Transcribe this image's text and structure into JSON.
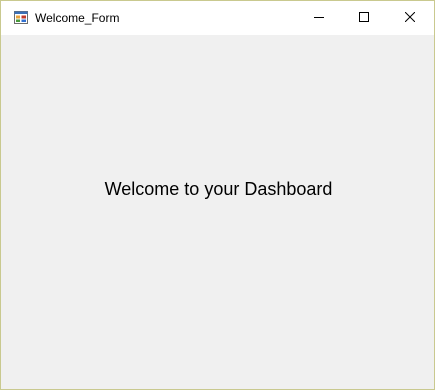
{
  "window": {
    "title": "Welcome_Form",
    "icon": "form-app-icon",
    "controls": {
      "minimize": "minimize-icon",
      "maximize": "maximize-icon",
      "close": "close-icon"
    }
  },
  "main": {
    "welcome_text": "Welcome to your Dashboard"
  },
  "colors": {
    "titlebar_bg": "#ffffff",
    "client_bg": "#f0f0f0",
    "border": "#c9c98f"
  }
}
